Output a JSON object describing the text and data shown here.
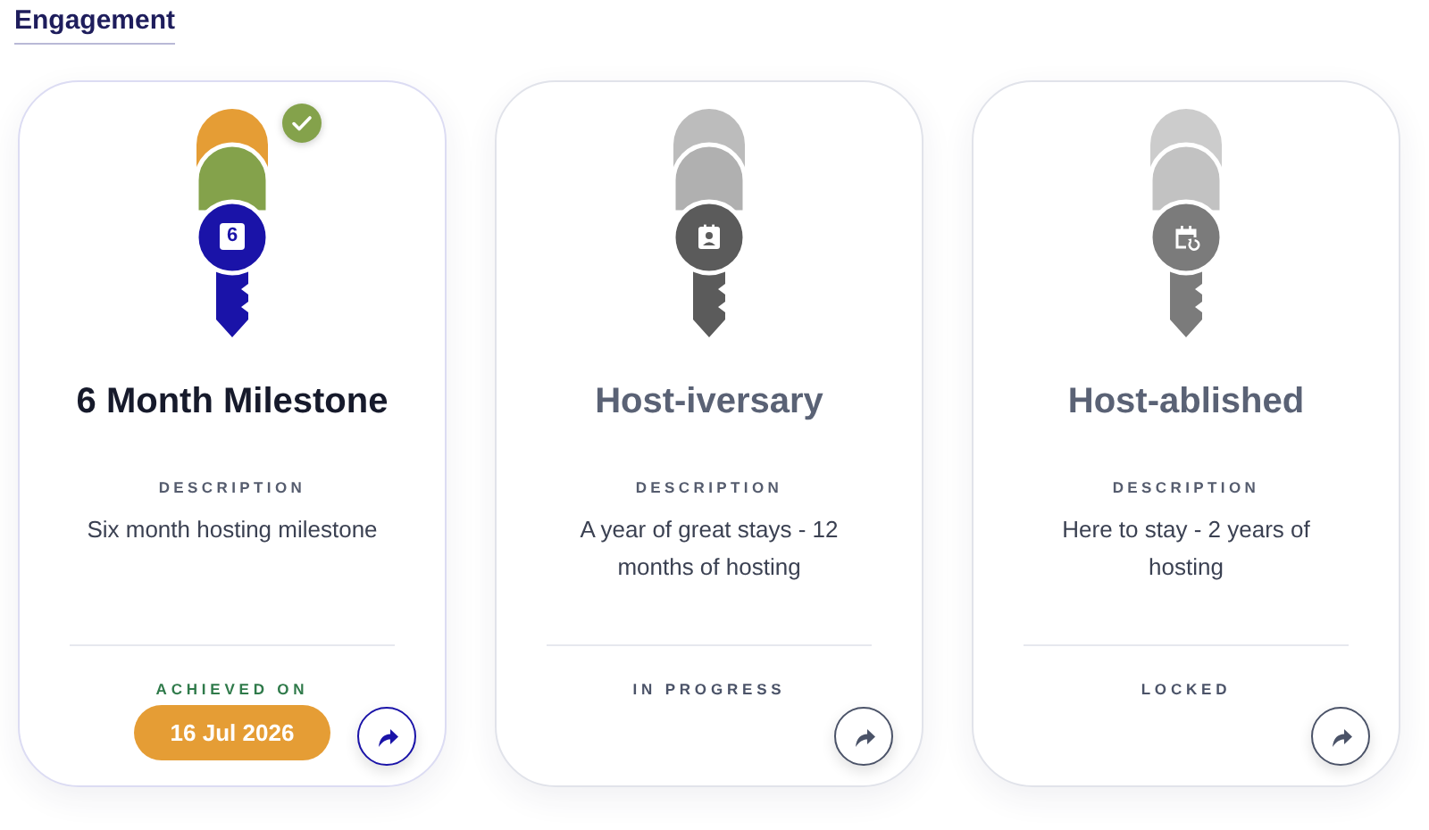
{
  "section_title": "Engagement",
  "cards": [
    {
      "kind": "achieved",
      "checked": true,
      "emblem": {
        "kind": "number",
        "text": "6"
      },
      "title": "6 Month Milestone",
      "description_label": "DESCRIPTION",
      "description": "Six month hosting milestone",
      "status_label": "ACHIEVED ON",
      "date": "16 Jul 2026"
    },
    {
      "kind": "in_progress",
      "checked": false,
      "emblem": {
        "kind": "person-card"
      },
      "title": "Host-iversary",
      "description_label": "DESCRIPTION",
      "description": "A year of great stays - 12 months of hosting",
      "status_label": "IN PROGRESS"
    },
    {
      "kind": "locked",
      "checked": false,
      "emblem": {
        "kind": "calendar-repeat"
      },
      "title": "Host-ablished",
      "description_label": "DESCRIPTION",
      "description": "Here to stay - 2 years of hosting",
      "status_label": "LOCKED"
    }
  ]
}
